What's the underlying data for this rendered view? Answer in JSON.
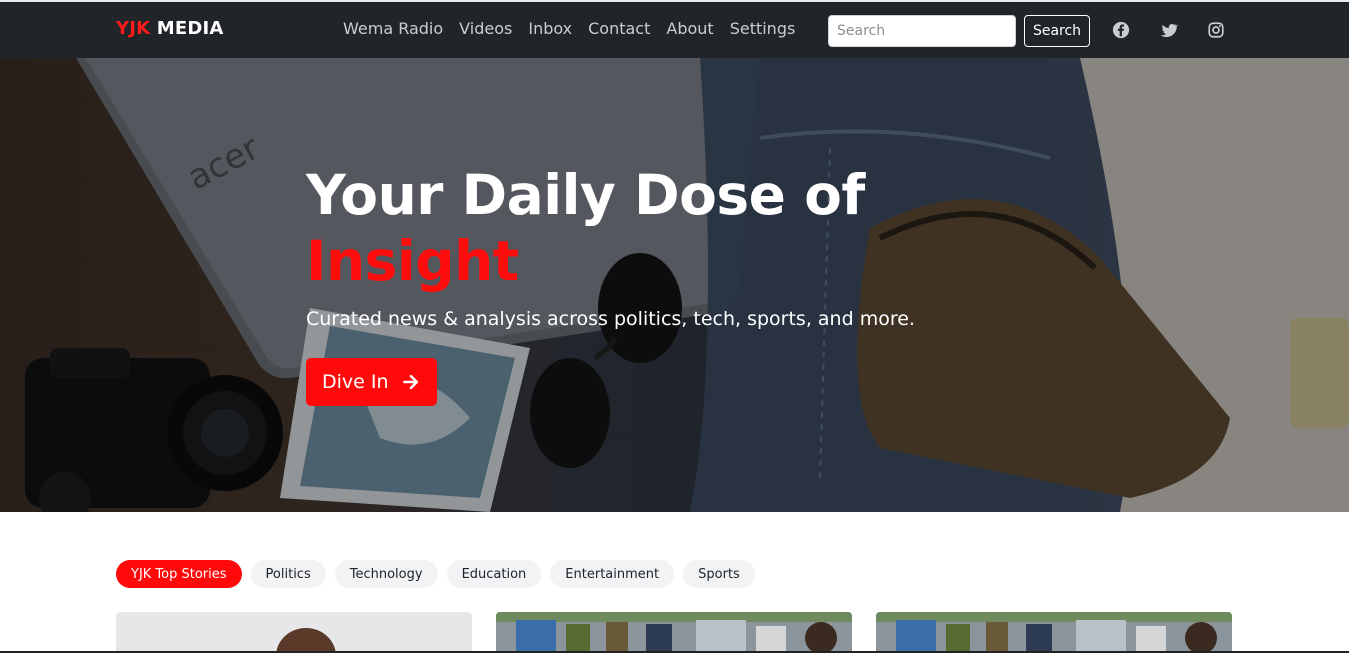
{
  "brand": {
    "accent": "YJK",
    "rest": " MEDIA"
  },
  "nav": {
    "links": [
      "Wema Radio",
      "Videos",
      "Inbox",
      "Contact",
      "About",
      "Settings"
    ]
  },
  "search": {
    "placeholder": "Search",
    "value": "",
    "button_label": "Search"
  },
  "social": [
    "facebook-icon",
    "twitter-icon",
    "instagram-icon"
  ],
  "hero": {
    "title_line1": "Your Daily Dose of",
    "title_accent": "Insight",
    "subtitle": "Curated news & analysis across politics, tech, sports, and more.",
    "cta_label": "Dive In",
    "cta_icon": "arrow-right-icon"
  },
  "categories": [
    "YJK Top Stories",
    "Politics",
    "Technology",
    "Education",
    "Entertainment",
    "Sports"
  ],
  "active_category": "YJK Top Stories",
  "colors": {
    "accent": "#ff0a0a",
    "navbar": "#212529",
    "pill_bg": "#f1f3f5"
  }
}
